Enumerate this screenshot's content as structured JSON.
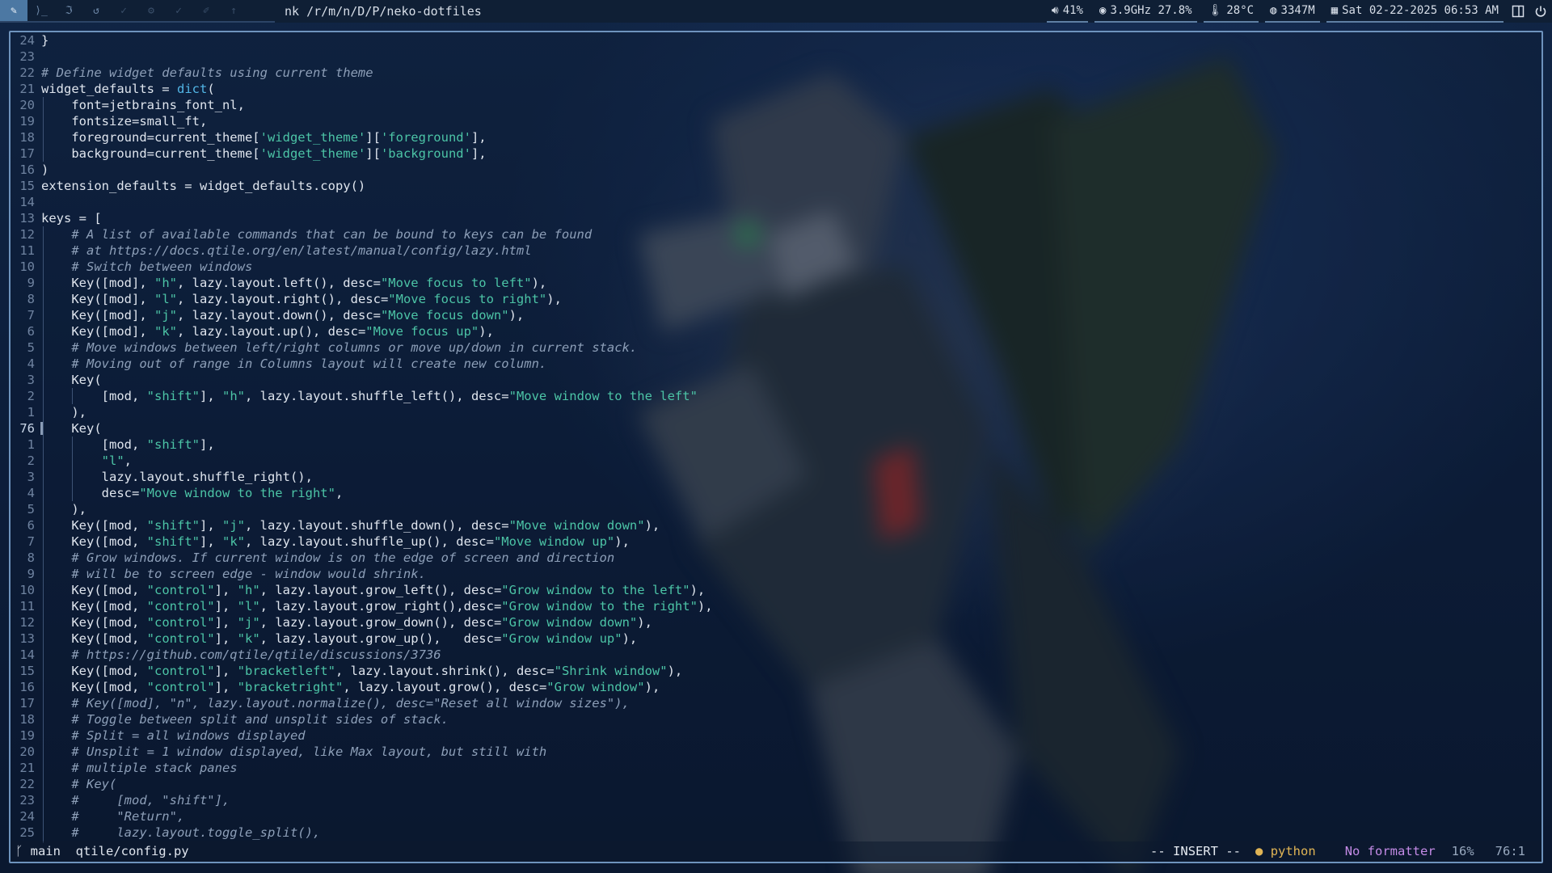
{
  "topbar": {
    "groups": [
      {
        "icon": "neovim-icon",
        "glyph": "✎",
        "active": true
      },
      {
        "icon": "terminal-icon",
        "glyph": "⟩_"
      },
      {
        "icon": "text-icon",
        "glyph": "ℑ"
      },
      {
        "icon": "refresh-icon",
        "glyph": "↺"
      },
      {
        "icon": "check-icon",
        "glyph": "✓"
      },
      {
        "icon": "gear-icon",
        "glyph": "⚙"
      },
      {
        "icon": "check-icon",
        "glyph": "✓"
      },
      {
        "icon": "pen-icon",
        "glyph": "✐"
      },
      {
        "icon": "arrow-icon",
        "glyph": "↑"
      }
    ],
    "window_title": "nk /r/m/n/D/P/neko-dotfiles",
    "volume": "41%",
    "cpu": "3.9GHz 27.8%",
    "temperature": "28°C",
    "memory": "3347M",
    "clock": "Sat 02-22-2025 06:53 AM"
  },
  "editor": {
    "lines": [
      {
        "n": "24",
        "code": "}"
      },
      {
        "n": "23",
        "code": ""
      },
      {
        "n": "22",
        "code": "# Define widget defaults using current theme",
        "comment": true
      },
      {
        "n": "21",
        "code": "widget_defaults = ",
        "tail_builtin": "dict",
        "tail": "("
      },
      {
        "n": "20",
        "code": "    font=jetbrains_font_nl,"
      },
      {
        "n": "19",
        "code": "    fontsize=small_ft,"
      },
      {
        "n": "18",
        "code": "    foreground=current_theme[",
        "s1": "'widget_theme'",
        "m1": "][",
        "s2": "'foreground'",
        "m2": "],"
      },
      {
        "n": "17",
        "code": "    background=current_theme[",
        "s1": "'widget_theme'",
        "m1": "][",
        "s2": "'background'",
        "m2": "],"
      },
      {
        "n": "16",
        "code": ")"
      },
      {
        "n": "15",
        "code": "extension_defaults = widget_defaults.copy()"
      },
      {
        "n": "14",
        "code": ""
      },
      {
        "n": "13",
        "code": "keys = ["
      },
      {
        "n": "12",
        "code": "    # A list of available commands that can be bound to keys can be found",
        "comment": true
      },
      {
        "n": "11",
        "code": "    # at https://docs.qtile.org/en/latest/manual/config/lazy.html",
        "comment": true
      },
      {
        "n": "10",
        "code": "    # Switch between windows",
        "comment": true
      },
      {
        "n": "9",
        "code": "    Key([mod], ",
        "s1": "\"h\"",
        "m1": ", lazy.layout.left(), desc=",
        "s2": "\"Move focus to left\"",
        "m2": "),"
      },
      {
        "n": "8",
        "code": "    Key([mod], ",
        "s1": "\"l\"",
        "m1": ", lazy.layout.right(), desc=",
        "s2": "\"Move focus to right\"",
        "m2": "),"
      },
      {
        "n": "7",
        "code": "    Key([mod], ",
        "s1": "\"j\"",
        "m1": ", lazy.layout.down(), desc=",
        "s2": "\"Move focus down\"",
        "m2": "),"
      },
      {
        "n": "6",
        "code": "    Key([mod], ",
        "s1": "\"k\"",
        "m1": ", lazy.layout.up(), desc=",
        "s2": "\"Move focus up\"",
        "m2": "),"
      },
      {
        "n": "5",
        "code": "    # Move windows between left/right columns or move up/down in current stack.",
        "comment": true
      },
      {
        "n": "4",
        "code": "    # Moving out of range in Columns layout will create new column.",
        "comment": true
      },
      {
        "n": "3",
        "code": "    Key("
      },
      {
        "n": "2",
        "code": "        [mod, ",
        "s1": "\"shift\"",
        "m1": "], ",
        "s2": "\"h\"",
        "m2": ", lazy.layout.shuffle_left(), desc=",
        "s3": "\"Move window to the left\"",
        "m3": ""
      },
      {
        "n": "1",
        "code": "    ),"
      },
      {
        "n": "76",
        "code": "    Key(",
        "current": true
      },
      {
        "n": "1",
        "code": "        [mod, ",
        "s1": "\"shift\"",
        "m1": "],"
      },
      {
        "n": "2",
        "code": "        ",
        "s1": "\"l\"",
        "m1": ","
      },
      {
        "n": "3",
        "code": "        lazy.layout.shuffle_right(),"
      },
      {
        "n": "4",
        "code": "        desc=",
        "s1": "\"Move window to the right\"",
        "m1": ","
      },
      {
        "n": "5",
        "code": "    ),"
      },
      {
        "n": "6",
        "code": "    Key([mod, ",
        "s1": "\"shift\"",
        "m1": "], ",
        "s2": "\"j\"",
        "m2": ", lazy.layout.shuffle_down(), desc=",
        "s3": "\"Move window down\"",
        "m3": "),"
      },
      {
        "n": "7",
        "code": "    Key([mod, ",
        "s1": "\"shift\"",
        "m1": "], ",
        "s2": "\"k\"",
        "m2": ", lazy.layout.shuffle_up(), desc=",
        "s3": "\"Move window up\"",
        "m3": "),"
      },
      {
        "n": "8",
        "code": "    # Grow windows. If current window is on the edge of screen and direction",
        "comment": true
      },
      {
        "n": "9",
        "code": "    # will be to screen edge - window would shrink.",
        "comment": true
      },
      {
        "n": "10",
        "code": "    Key([mod, ",
        "s1": "\"control\"",
        "m1": "], ",
        "s2": "\"h\"",
        "m2": ", lazy.layout.grow_left(), desc=",
        "s3": "\"Grow window to the left\"",
        "m3": "),"
      },
      {
        "n": "11",
        "code": "    Key([mod, ",
        "s1": "\"control\"",
        "m1": "], ",
        "s2": "\"l\"",
        "m2": ", lazy.layout.grow_right(),desc=",
        "s3": "\"Grow window to the right\"",
        "m3": "),"
      },
      {
        "n": "12",
        "code": "    Key([mod, ",
        "s1": "\"control\"",
        "m1": "], ",
        "s2": "\"j\"",
        "m2": ", lazy.layout.grow_down(), desc=",
        "s3": "\"Grow window down\"",
        "m3": "),"
      },
      {
        "n": "13",
        "code": "    Key([mod, ",
        "s1": "\"control\"",
        "m1": "], ",
        "s2": "\"k\"",
        "m2": ", lazy.layout.grow_up(),   desc=",
        "s3": "\"Grow window up\"",
        "m3": "),"
      },
      {
        "n": "14",
        "code": "    # https://github.com/qtile/qtile/discussions/3736",
        "comment": true
      },
      {
        "n": "15",
        "code": "    Key([mod, ",
        "s1": "\"control\"",
        "m1": "], ",
        "s2": "\"bracketleft\"",
        "m2": ", lazy.layout.shrink(), desc=",
        "s3": "\"Shrink window\"",
        "m3": "),"
      },
      {
        "n": "16",
        "code": "    Key([mod, ",
        "s1": "\"control\"",
        "m1": "], ",
        "s2": "\"bracketright\"",
        "m2": ", lazy.layout.grow(), desc=",
        "s3": "\"Grow window\"",
        "m3": "),"
      },
      {
        "n": "17",
        "code": "    # Key([mod], \"n\", lazy.layout.normalize(), desc=\"Reset all window sizes\"),",
        "comment": true
      },
      {
        "n": "18",
        "code": "    # Toggle between split and unsplit sides of stack.",
        "comment": true
      },
      {
        "n": "19",
        "code": "    # Split = all windows displayed",
        "comment": true
      },
      {
        "n": "20",
        "code": "    # Unsplit = 1 window displayed, like Max layout, but still with",
        "comment": true
      },
      {
        "n": "21",
        "code": "    # multiple stack panes",
        "comment": true
      },
      {
        "n": "22",
        "code": "    # Key(",
        "comment": true
      },
      {
        "n": "23",
        "code": "    #     [mod, \"shift\"],",
        "comment": true
      },
      {
        "n": "24",
        "code": "    #     \"Return\",",
        "comment": true
      },
      {
        "n": "25",
        "code": "    #     lazy.layout.toggle_split(),",
        "comment": true
      }
    ]
  },
  "statusline": {
    "branch_icon": "git-branch-icon",
    "branch": "main",
    "file": "qtile/config.py",
    "mode": "-- INSERT --",
    "language": "python",
    "formatter": "No formatter",
    "percent": "16%",
    "position": "76:1"
  },
  "colors": {
    "accent": "#4c78a3",
    "string": "#4cc4a6",
    "comment": "#8d9fb8",
    "builtin": "#52b6e6",
    "formatter": "#c48be6",
    "language": "#e0b455"
  }
}
